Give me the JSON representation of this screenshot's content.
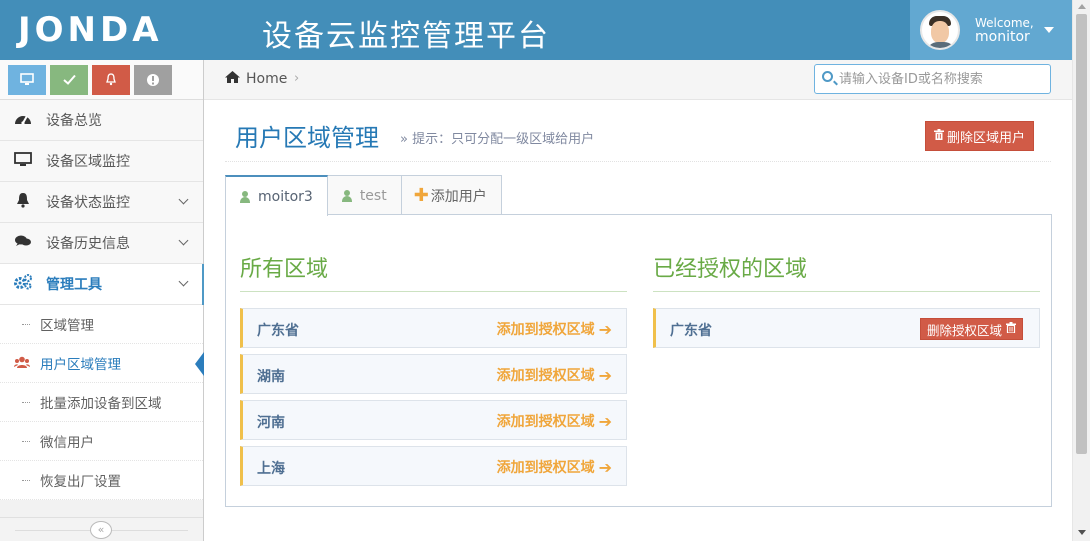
{
  "header": {
    "logo": "JONDA",
    "title": "设备云监控管理平台",
    "user": {
      "welcome": "Welcome,",
      "name": "monitor"
    }
  },
  "sidebar": {
    "shortcuts": [
      {
        "icon": "monitor-icon",
        "color": "#6fb3e0"
      },
      {
        "icon": "check-icon",
        "color": "#87b87f"
      },
      {
        "icon": "bell-icon",
        "color": "#d15b47"
      },
      {
        "icon": "alert-icon",
        "color": "#a0a0a0"
      }
    ],
    "items": [
      {
        "label": "设备总览",
        "icon": "dashboard-icon"
      },
      {
        "label": "设备区域监控",
        "icon": "desktop-icon"
      },
      {
        "label": "设备状态监控",
        "icon": "bell-icon"
      },
      {
        "label": "设备历史信息",
        "icon": "comments-icon"
      },
      {
        "label": "管理工具",
        "icon": "cogs-icon"
      }
    ],
    "submenu": [
      {
        "label": "区域管理"
      },
      {
        "label": "用户区域管理",
        "icon": "users-icon"
      },
      {
        "label": "批量添加设备到区域"
      },
      {
        "label": "微信用户"
      },
      {
        "label": "恢复出厂设置"
      }
    ],
    "collapse": "«"
  },
  "breadcrumbs": {
    "home": "Home",
    "sep": "›"
  },
  "search": {
    "placeholder": "请输入设备ID或名称搜索"
  },
  "page": {
    "title": "用户区域管理",
    "hint": "» 提示：只可分配一级区域给用户",
    "delete_user_label": "删除区域用户"
  },
  "tabs": [
    {
      "label": "moitor3"
    },
    {
      "label": "test"
    },
    {
      "label": "添加用户"
    }
  ],
  "all_regions": {
    "title": "所有区域",
    "action_label": "添加到授权区域",
    "items": [
      {
        "name": "广东省"
      },
      {
        "name": "湖南"
      },
      {
        "name": "河南"
      },
      {
        "name": "上海"
      }
    ]
  },
  "authorized_regions": {
    "title": "已经授权的区域",
    "action_label": "删除授权区域",
    "items": [
      {
        "name": "广东省"
      }
    ]
  },
  "colors": {
    "header": "#438eb9",
    "accent_blue": "#2679b5",
    "green": "#69aa46",
    "orange": "#f0a63b",
    "danger": "#d15b47"
  }
}
